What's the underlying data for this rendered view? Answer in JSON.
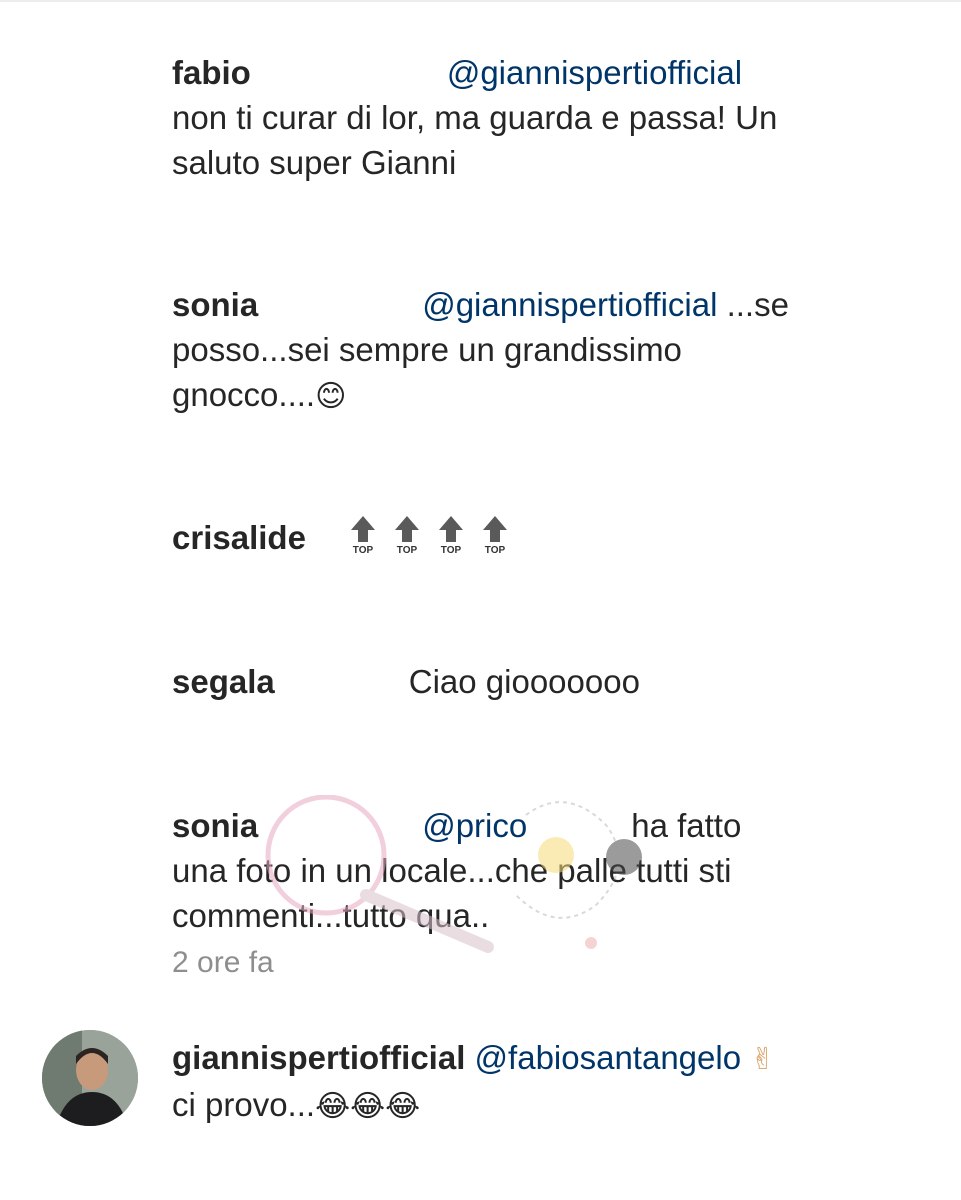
{
  "comments": [
    {
      "user": "fabio",
      "mention": "@giannispertiofficial",
      "text_line1": "non ti curar di lor, ma guarda e passa!  Un",
      "text_line2": "saluto super Gianni"
    },
    {
      "user": "sonia",
      "mention": "@giannispertiofficial",
      "text_after": " ...se",
      "text_line2": "posso...sei sempre un grandissimo",
      "text_line3": "gnocco....",
      "emoji": "😊"
    },
    {
      "user": "crisalide",
      "icon": "top-arrow-icon",
      "icon_label": "TOP",
      "icon_count": 4
    },
    {
      "user": "segala",
      "text": "Ciao giooooooo"
    },
    {
      "user": "sonia",
      "mention": "@prico",
      "text_after": "ha fatto",
      "text_line2": "una foto in un locale...che palle tutti sti",
      "text_line3": "commenti...tutto qua..",
      "time": "2 ore fa"
    },
    {
      "user": "giannispertiofficial",
      "mention": "@fabiosantangelo",
      "emoji_peace": "✌",
      "text_line2": "ci provo...",
      "emoji_laugh": "😂😂😂"
    }
  ],
  "colors": {
    "username": "#262626",
    "mention": "#003569",
    "meta": "#8e8e8e"
  }
}
